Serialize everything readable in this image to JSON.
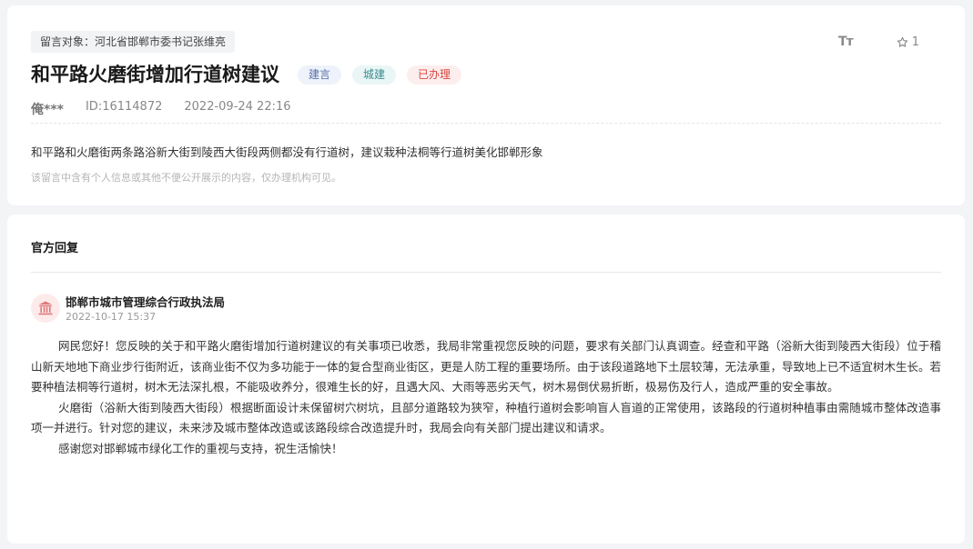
{
  "message": {
    "target": "留言对象：河北省邯郸市委书记张维亮",
    "title": "和平路火磨街增加行道树建议",
    "tags": [
      "建言",
      "城建",
      "已办理"
    ],
    "author": "俺***",
    "id": "ID:16114872",
    "datetime": "2022-09-24 22:16",
    "content": "和平路和火磨街两条路浴新大街到陵西大街段两侧都没有行道树，建议栽种法桐等行道树美化邯郸形象",
    "privacy_notice": "该留言中含有个人信息或其他不便公开展示的内容，仅办理机构可见。",
    "tools": {
      "font_icon": "font-size-icon",
      "font_label": "Tт",
      "fav_icon": "star-icon",
      "fav_count": "1"
    }
  },
  "reply": {
    "heading": "官方回复",
    "org_icon": "government-building-icon",
    "org_name": "邯郸市城市管理综合行政执法局",
    "time": "2022-10-17 15:37",
    "paragraphs": [
      "网民您好！您反映的关于和平路火磨街增加行道树建议的有关事项已收悉，我局非常重视您反映的问题，要求有关部门认真调查。经查和平路（浴新大街到陵西大街段）位于稽山新天地地下商业步行街附近，该商业街不仅为多功能于一体的复合型商业街区，更是人防工程的重要场所。由于该段道路地下土层较薄，无法承重，导致地上已不适宜树木生长。若要种植法桐等行道树，树木无法深扎根，不能吸收养分，很难生长的好，且遇大风、大雨等恶劣天气，树木易倒伏易折断，极易伤及行人，造成严重的安全事故。",
      "火磨街（浴新大街到陵西大街段）根据断面设计未保留树穴树坑，且部分道路较为狭窄，种植行道树会影响盲人盲道的正常使用，该路段的行道树种植事由需随城市整体改造事项一并进行。针对您的建议，未来涉及城市整体改造或该路段综合改造提升时，我局会向有关部门提出建议和请求。",
      "感谢您对邯郸城市绿化工作的重视与支持，祝生活愉快！"
    ]
  },
  "colors": {
    "page_bg": "#f3f4f6",
    "tag_suggestion": "#5571a8",
    "tag_construction": "#3c8c8e",
    "tag_done": "#d9453e",
    "org_icon": "#e07a7a"
  }
}
